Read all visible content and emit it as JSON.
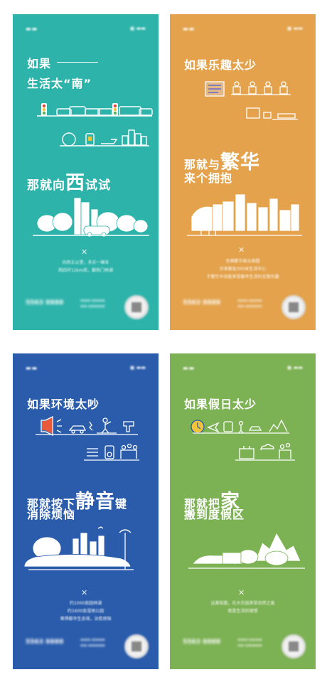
{
  "posters": [
    {
      "id": "south",
      "color": "#2db3aa",
      "line1": "如果",
      "line2": "生活太“南”",
      "cta_pre": "那就向",
      "cta_big": "西",
      "cta_post": "试试",
      "body": [
        "向西五公里，多买一辆车",
        "西四环12km房，都热门林湖"
      ],
      "phone": "5563 8888"
    },
    {
      "id": "fun",
      "color": "#e3a24b",
      "line1": "如果乐趣太少",
      "cta_pre": "那就与",
      "cta_big": "繁华",
      "line3": "来个拥抱",
      "body": [
        "坐拥繁华商业商圈",
        "尽享都会300米生活中心",
        "于繁忙中自能享受都市生活的无限乐趣"
      ],
      "phone": "5563 8888"
    },
    {
      "id": "noise",
      "color": "#2a5cab",
      "line1": "如果环境太吵",
      "cta_pre": "那就按下",
      "cta_big": "静音",
      "cta_post": "键",
      "line3": "消除烦恼",
      "body": [
        "约1000亩园林湖",
        "约1600亩湿地公园",
        "难得都市生态境，治愈烦恼"
      ],
      "phone": "5563 8888"
    },
    {
      "id": "holiday",
      "color": "#7cb154",
      "line1": "如果假日太少",
      "cta_pre": "那就把",
      "cta_big": "家",
      "line3": "搬到度假区",
      "body": [
        "远离喧嚣，在大乐园享受自然之美",
        "就是生活的理想"
      ],
      "phone": "5563 8888"
    }
  ]
}
